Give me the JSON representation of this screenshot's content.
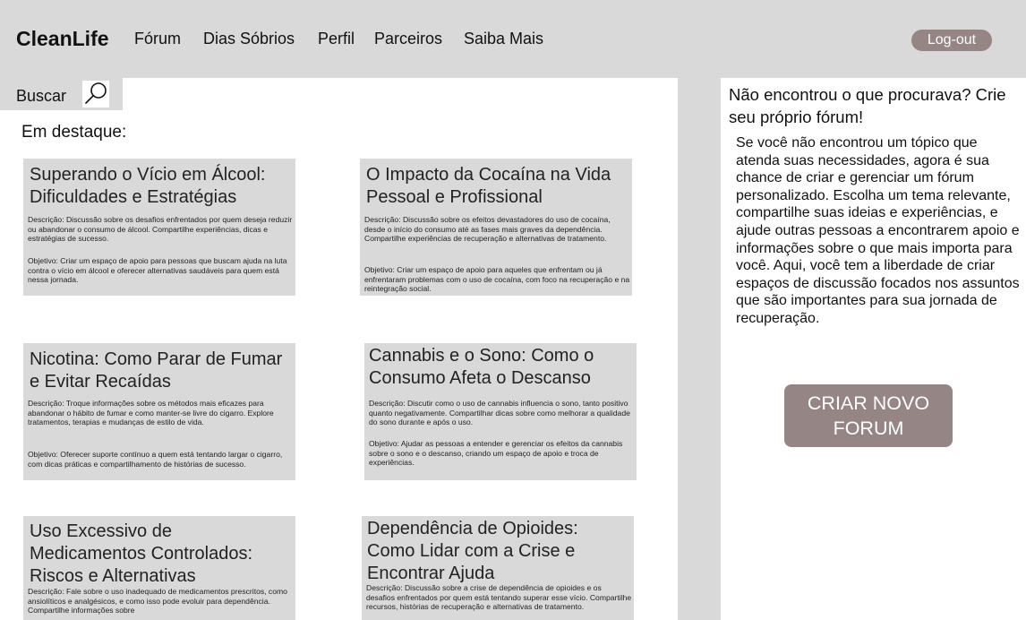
{
  "app": {
    "logo": "CleanLife"
  },
  "nav": {
    "forum": "Fórum",
    "sober_days": "Dias Sóbrios",
    "profile": "Perfil",
    "partners": "Parceiros",
    "learn_more": "Saiba Mais",
    "logout": "Log-out"
  },
  "search": {
    "label": "Buscar",
    "icon": "search-icon"
  },
  "featured_label": "Em destaque:",
  "cards": [
    {
      "title": "Superando o Vício em Álcool: Dificuldades e Estratégias",
      "description": "Descrição: Discussão sobre os desafios enfrentados por quem deseja reduzir ou abandonar o consumo de álcool. Compartilhe experiências, dicas e estratégias de sucesso.",
      "goal": "Objetivo: Criar um espaço de apoio para pessoas que buscam ajuda na luta contra o vício em álcool e oferecer alternativas saudáveis para quem está nessa jornada."
    },
    {
      "title": "O Impacto da Cocaína na Vida Pessoal e Profissional",
      "description": "Descrição: Discussão sobre os efeitos devastadores do uso de cocaína, desde o início do consumo até as fases mais graves da dependência. Compartilhe experiências de recuperação e alternativas de tratamento.",
      "goal": "Objetivo: Criar um espaço de apoio para aqueles que enfrentam ou já enfrentaram problemas com o uso de cocaína, com foco na recuperação e na reintegração social."
    },
    {
      "title": "Nicotina: Como Parar de Fumar e Evitar Recaídas",
      "description": "Descrição: Troque informações sobre os métodos mais eficazes para abandonar o hábito de fumar e como manter-se livre do cigarro. Explore tratamentos, terapias e mudanças de estilo de vida.",
      "goal": "Objetivo: Oferecer suporte contínuo a quem está tentando largar o cigarro, com dicas práticas e compartilhamento de histórias de sucesso."
    },
    {
      "title": "Cannabis e o Sono: Como o Consumo Afeta o Descanso",
      "description": "Descrição: Discutir como o uso de cannabis influencia o sono, tanto positivo quanto negativamente. Compartilhar dicas sobre como melhorar a qualidade do sono durante e após o uso.",
      "goal": "Objetivo: Ajudar as pessoas a entender e gerenciar os efeitos da cannabis sobre o sono e o descanso, criando um espaço de apoio e troca de experiências."
    },
    {
      "title": "Uso Excessivo de Medicamentos Controlados: Riscos e Alternativas",
      "description": "Descrição: Fale sobre o uso inadequado de medicamentos prescritos, como ansiolíticos e analgésicos, e como isso pode evoluir para dependência. Compartilhe informações sobre",
      "goal": ""
    },
    {
      "title": "Dependência de Opioides: Como Lidar com a Crise e Encontrar Ajuda",
      "description": "Descrição: Discussão sobre a crise de dependência de opioides e os desafios enfrentados por quem está tentando superar esse vício. Compartilhe recursos, histórias de recuperação e alternativas de tratamento.",
      "goal": ""
    }
  ],
  "sidebar": {
    "title": "Não encontrou o que procurava? Crie seu próprio fórum!",
    "text": "Se você não encontrou um tópico que atenda suas necessidades, agora é sua chance de criar e gerenciar um fórum personalizado. Escolha um tema relevante, compartilhe suas ideias e experiências, e ajude outras pessoas a encontrarem apoio e informações sobre o que mais importa para você. Aqui, você tem a liberdade de criar espaços de discussão focados nos assuntos que são importantes para sua jornada de recuperação.",
    "button": "CRIAR NOVO FORUM"
  },
  "colors": {
    "bar": "#d9d9d9",
    "button": "#958585",
    "content": "#ffffff"
  }
}
